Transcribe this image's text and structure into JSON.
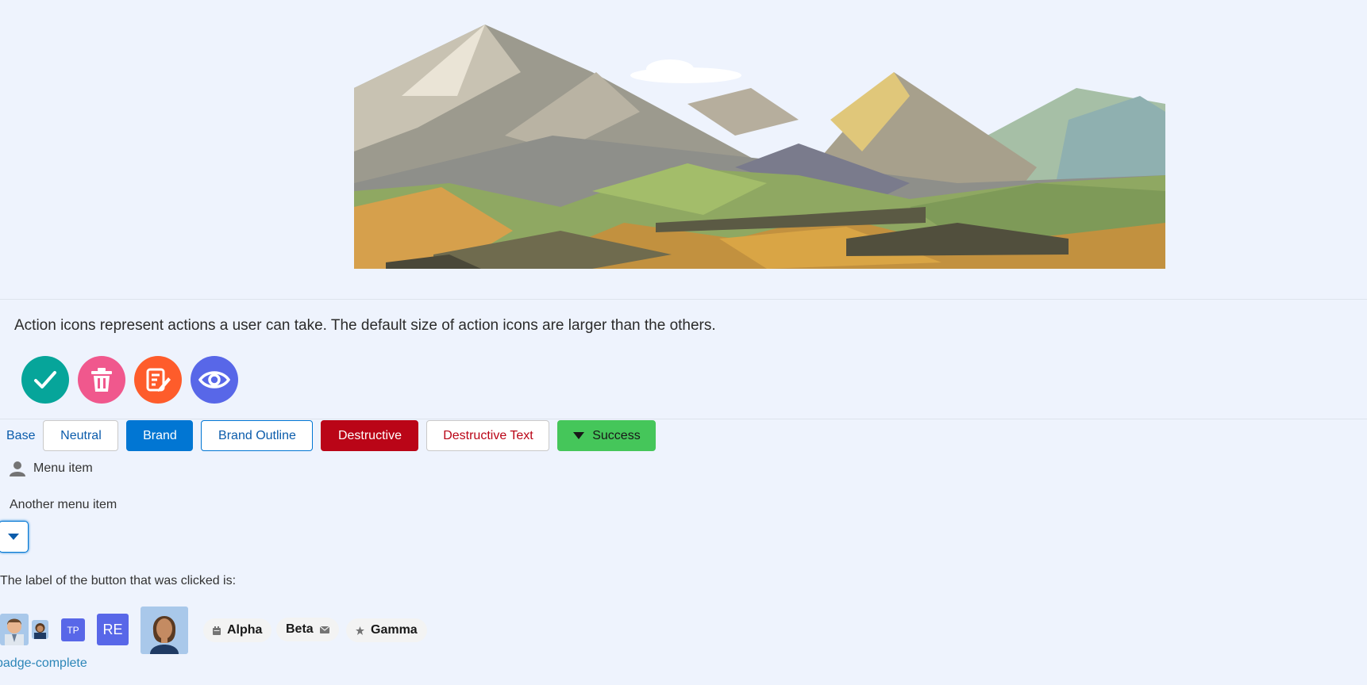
{
  "hero": {
    "image": "mountain-landscape-illustration"
  },
  "description": "Action icons represent actions a user can take. The default size of action icons are larger than the others.",
  "action_icons": [
    {
      "name": "approval-icon",
      "color": "#06a59a"
    },
    {
      "name": "delete-icon",
      "color": "#f0588d"
    },
    {
      "name": "edit-notes-icon",
      "color": "#fe5c2b"
    },
    {
      "name": "preview-icon",
      "color": "#5867e8"
    }
  ],
  "buttons": {
    "base": "Base",
    "neutral": "Neutral",
    "brand": "Brand",
    "brand_outline": "Brand Outline",
    "destructive": "Destructive",
    "destructive_text": "Destructive Text",
    "success": "Success"
  },
  "menu": {
    "item1": "Menu item",
    "item2": "Another menu item"
  },
  "clicked_label": "The label of the button that was clicked is:",
  "avatars": {
    "initials_small": "TP",
    "initials_large": "RE"
  },
  "badges": {
    "alpha": "Alpha",
    "beta": "Beta",
    "gamma": "Gamma"
  },
  "complete_text": "badge-complete",
  "colors": {
    "background": "#eef3fd",
    "brand": "#0176d3",
    "destructive": "#ba0517",
    "success": "#45c65a",
    "avatar_initials": "#5867e8"
  }
}
